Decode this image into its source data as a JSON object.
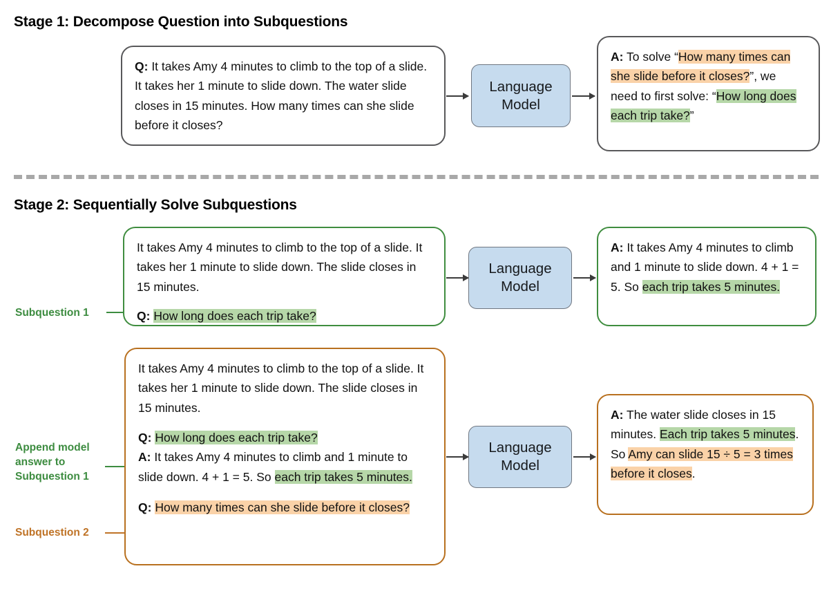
{
  "stage1": {
    "title": "Stage 1: Decompose Question into Subquestions",
    "question_card": {
      "label": "Q:",
      "text": " It takes Amy 4 minutes to climb to the top of a slide. It takes her 1 minute to slide down. The water slide closes in 15 minutes. How many times can she slide before it closes?"
    },
    "model_box": "Language\nModel",
    "model_line1": "Language",
    "model_line2": "Model",
    "answer_card": {
      "label": "A:",
      "part1": " To solve “",
      "hl_orange": "How many times can she slide before it closes?",
      "part2": "”, we need to first solve: “",
      "hl_green": "How long does each trip take?",
      "part3": "”"
    }
  },
  "stage2": {
    "title": "Stage 2: Sequentially Solve Subquestions",
    "row1": {
      "annotation": "Subquestion 1",
      "prompt_context": "It takes Amy 4 minutes to climb to the top of a slide. It takes her 1 minute to slide down. The slide closes in 15 minutes.",
      "q_label": "Q:",
      "q_text": "How long does each trip take?",
      "model_line1": "Language",
      "model_line2": "Model",
      "answer": {
        "label": "A:",
        "part1": " It takes Amy 4 minutes to climb and 1 minute to slide down. 4 + 1 = 5. So ",
        "hl_green": "each trip takes 5 minutes.",
        "part2": ""
      }
    },
    "row2": {
      "annotation_append": "Append model\nanswer to\nSubquestion 1",
      "annotation_append_l1": "Append model",
      "annotation_append_l2": "answer to",
      "annotation_append_l3": "Subquestion 1",
      "annotation_sub2": "Subquestion 2",
      "prompt_context": "It takes Amy 4 minutes to climb to the top of a slide. It takes her 1 minute to slide down. The slide closes in 15 minutes.",
      "q1_label": "Q:",
      "q1_text": "How long does each trip take?",
      "a1_label": "A:",
      "a1_part1": " It takes Amy 4 minutes to climb and 1 minute to slide down. 4 + 1 = 5. So ",
      "a1_hl_green": "each trip takes 5 minutes.",
      "q2_label": "Q:",
      "q2_text": "How many times can she slide before it closes?",
      "model_line1": "Language",
      "model_line2": "Model",
      "answer": {
        "label": "A:",
        "part1": " The water slide closes in 15 minutes. ",
        "hl_green": "Each trip takes 5 minutes",
        "part2": ". So ",
        "hl_orange": "Amy can slide 15 ÷ 5 = 3 times before it closes",
        "part3": "."
      }
    }
  },
  "colors": {
    "highlight_green": "#b6d7a8",
    "highlight_orange": "#fad2a8",
    "border_green": "#3f8d3f",
    "border_orange": "#b8701f",
    "border_gray": "#58585a",
    "lm_fill": "#c6dbee",
    "annotation_green": "#3d8c40",
    "annotation_orange": "#bf7326",
    "divider_gray": "#a8a8a8"
  }
}
